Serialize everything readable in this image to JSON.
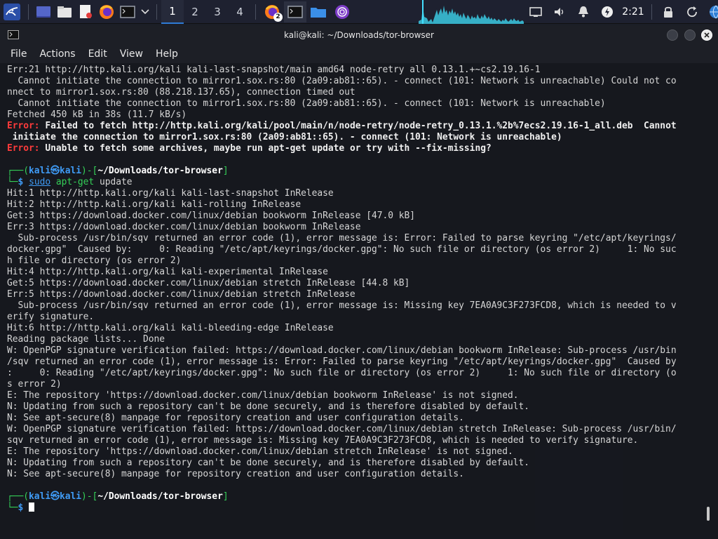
{
  "panel": {
    "workspaces": [
      "1",
      "2",
      "3",
      "4"
    ],
    "active_workspace": "1",
    "firefox_badge": "2",
    "clock": "2:21",
    "launchers": [
      "kali-menu-icon",
      "show-desktop-icon",
      "file-manager-icon",
      "text-editor-icon",
      "firefox-icon",
      "terminal-icon",
      "launcher-menu-chevron-icon"
    ],
    "tray": [
      "display-icon",
      "volume-icon",
      "notifications-icon",
      "power-manager-icon",
      "lock-icon",
      "restart-icon",
      "network-globe-icon"
    ],
    "accent_color": "#2e7bd6"
  },
  "window": {
    "title": "kali@kali: ~/Downloads/tor-browser",
    "menu": [
      "File",
      "Actions",
      "Edit",
      "View",
      "Help"
    ]
  },
  "terminal": {
    "pre_lines": [
      "Err:21 http://http.kali.org/kali kali-last-snapshot/main amd64 node-retry all 0.13.1.+~cs2.19.16-1",
      "  Cannot initiate the connection to mirror1.sox.rs:80 (2a09:ab81::65). - connect (101: Network is unreachable) Could not co",
      "nnect to mirror1.sox.rs:80 (88.218.137.65), connection timed out",
      "  Cannot initiate the connection to mirror1.sox.rs:80 (2a09:ab81::65). - connect (101: Network is unreachable)",
      "Fetched 450 kB in 38s (11.7 kB/s)"
    ],
    "error_label": "Error:",
    "error1_line1": " Failed to fetch http://http.kali.org/kali/pool/main/n/node-retry/node-retry_0.13.1.%2b%7ecs2.19.16-1_all.deb  Cannot",
    "error1_line2": " initiate the connection to mirror1.sox.rs:80 (2a09:ab81::65). - connect (101: Network is unreachable)",
    "error2": " Unable to fetch some archives, maybe run apt-get update or try with --fix-missing?",
    "prompt": {
      "corner_top": "┌──(",
      "user": "kali",
      "at": "㉿",
      "host": "kali",
      "mid": ")-[",
      "path": "~/Downloads/tor-browser",
      "end": "]",
      "corner_bottom": "└─",
      "dollar": "$ "
    },
    "command": {
      "sudo": "sudo",
      "cmd": " apt-get",
      "args": " update"
    },
    "output_lines": [
      "Hit:1 http://http.kali.org/kali kali-last-snapshot InRelease",
      "Hit:2 http://http.kali.org/kali kali-rolling InRelease",
      "Get:3 https://download.docker.com/linux/debian bookworm InRelease [47.0 kB]",
      "Err:3 https://download.docker.com/linux/debian bookworm InRelease",
      "  Sub-process /usr/bin/sqv returned an error code (1), error message is: Error: Failed to parse keyring \"/etc/apt/keyrings/",
      "docker.gpg\"  Caused by:     0: Reading \"/etc/apt/keyrings/docker.gpg\": No such file or directory (os error 2)     1: No suc",
      "h file or directory (os error 2)",
      "Hit:4 http://http.kali.org/kali kali-experimental InRelease",
      "Get:5 https://download.docker.com/linux/debian stretch InRelease [44.8 kB]",
      "Err:5 https://download.docker.com/linux/debian stretch InRelease",
      "  Sub-process /usr/bin/sqv returned an error code (1), error message is: Missing key 7EA0A9C3F273FCD8, which is needed to v",
      "erify signature.",
      "Hit:6 http://http.kali.org/kali kali-bleeding-edge InRelease",
      "Reading package lists... Done",
      "W: OpenPGP signature verification failed: https://download.docker.com/linux/debian bookworm InRelease: Sub-process /usr/bin",
      "/sqv returned an error code (1), error message is: Error: Failed to parse keyring \"/etc/apt/keyrings/docker.gpg\"  Caused by",
      ":     0: Reading \"/etc/apt/keyrings/docker.gpg\": No such file or directory (os error 2)     1: No such file or directory (o",
      "s error 2)",
      "E: The repository 'https://download.docker.com/linux/debian bookworm InRelease' is not signed.",
      "N: Updating from such a repository can't be done securely, and is therefore disabled by default.",
      "N: See apt-secure(8) manpage for repository creation and user configuration details.",
      "W: OpenPGP signature verification failed: https://download.docker.com/linux/debian stretch InRelease: Sub-process /usr/bin/",
      "sqv returned an error code (1), error message is: Missing key 7EA0A9C3F273FCD8, which is needed to verify signature.",
      "E: The repository 'https://download.docker.com/linux/debian stretch InRelease' is not signed.",
      "N: Updating from such a repository can't be done securely, and is therefore disabled by default.",
      "N: See apt-secure(8) manpage for repository creation and user configuration details."
    ]
  }
}
